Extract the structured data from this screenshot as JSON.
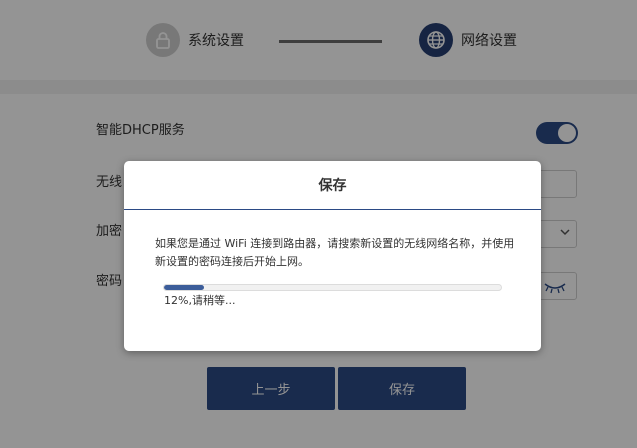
{
  "stepper": {
    "steps": [
      {
        "label": "系统设置",
        "icon": "lock-icon",
        "state": "inactive"
      },
      {
        "label": "网络设置",
        "icon": "globe-icon",
        "state": "active"
      }
    ]
  },
  "form": {
    "dhcp_label": "智能DHCP服务",
    "dhcp_enabled": true,
    "ssid_label": "无线",
    "encryption_label": "加密",
    "password_label": "密码"
  },
  "buttons": {
    "prev_label": "上一步",
    "save_label": "保存"
  },
  "modal": {
    "title": "保存",
    "message": "如果您是通过 WiFi 连接到路由器，请搜索新设置的无线网络名称，并使用新设置的密码连接后开始上网。",
    "progress_percent": 12,
    "progress_text": "12%,请稍等..."
  },
  "colors": {
    "accent": "#2b4a85",
    "progress": "#3c5d9a"
  }
}
